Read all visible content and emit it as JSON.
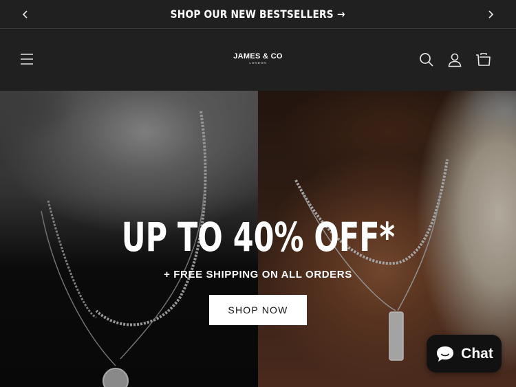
{
  "announcement": {
    "message": "SHOP OUR NEW BESTSELLERS",
    "message_arrow": "→",
    "prev_icon": "chevron-left-icon",
    "next_icon": "chevron-right-icon"
  },
  "header": {
    "logo_name": "JAMES & CO",
    "logo_sub": "LONDON",
    "icons": [
      "menu-icon",
      "search-icon",
      "account-icon",
      "cart-icon"
    ]
  },
  "hero": {
    "title": "UP TO 40% OFF*",
    "subtitle": "+ FREE SHIPPING ON ALL ORDERS",
    "button_label": "SHOP NOW"
  },
  "chat": {
    "label": "Chat",
    "icon": "chat-bubble-icon"
  },
  "colors": {
    "bar_bg": "#202020",
    "button_bg": "#ffffff",
    "text": "#ffffff"
  }
}
